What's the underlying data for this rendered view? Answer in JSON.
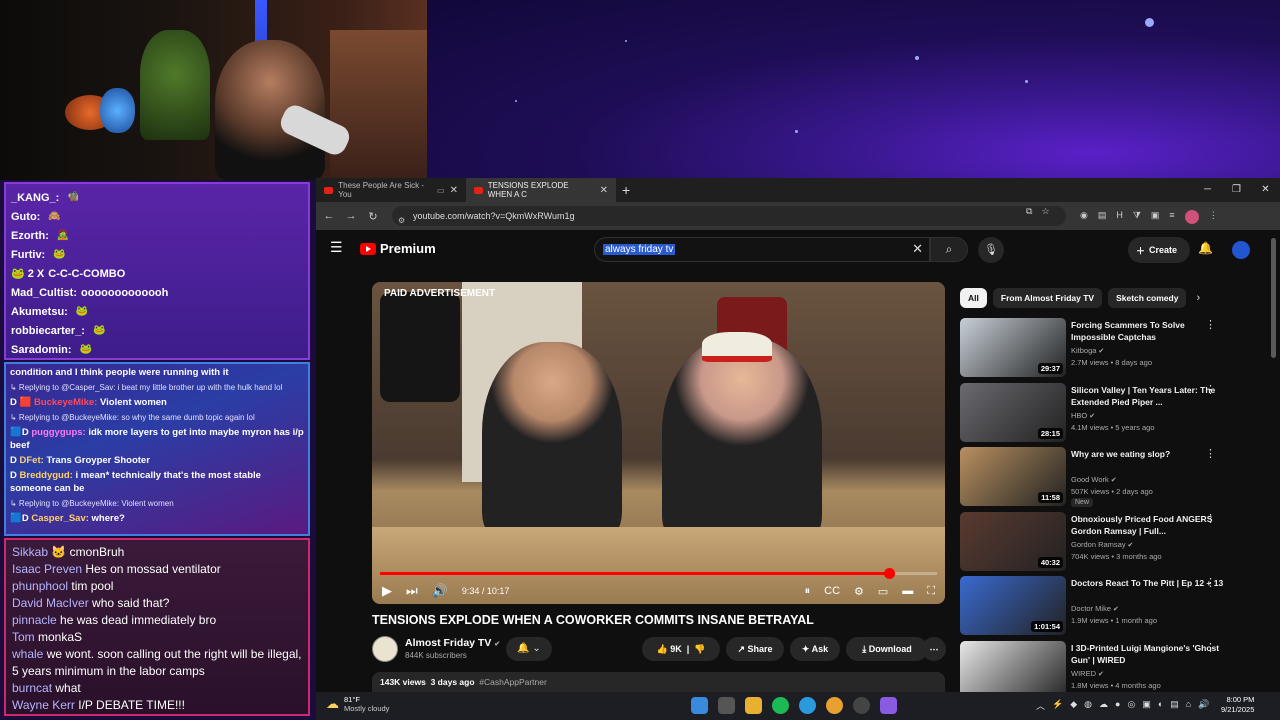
{
  "chat_top": [
    {
      "user": "_KANG_:",
      "msg": "",
      "emote": "🧌"
    },
    {
      "user": "Guto:",
      "msg": "",
      "emote": "🙈"
    },
    {
      "user": "Ezorth:",
      "msg": "",
      "emote": "🧟"
    },
    {
      "user": "Furtiv:",
      "msg": "",
      "emote": "🐸"
    },
    {
      "user": "🐸 2 X",
      "msg": "C-C-C-COMBO",
      "emote": ""
    },
    {
      "user": "Mad_Cultist:",
      "msg": "ooooooooooooh",
      "emote": ""
    },
    {
      "user": "Akumetsu:",
      "msg": "",
      "emote": "🐸"
    },
    {
      "user": "robbiecarter_:",
      "msg": "",
      "emote": "🐸"
    },
    {
      "user": "Saradomin:",
      "msg": "",
      "emote": "🐸"
    }
  ],
  "chat_mid": {
    "lead": "condition and I think people were running with it",
    "items": [
      {
        "reply": "↳ Replying to @Casper_Sav: i beat my little brother up with the hulk hand lol",
        "prefix": "D 🟥",
        "user": "BuckeyeMike:",
        "msg": "Violent women",
        "color": "red"
      },
      {
        "reply": "↳ Replying to @BuckeyeMike: so why the same dumb topic again lol",
        "prefix": "🟦D",
        "user": "puggygups:",
        "msg": "idk more layers to get into maybe myron has i/p beef",
        "color": "pink"
      },
      {
        "reply": "",
        "prefix": "D",
        "user": "DFet:",
        "msg": "Trans Groyper Shooter",
        "color": "yellow"
      },
      {
        "reply": "",
        "prefix": "D",
        "user": "Breddygud:",
        "msg": "i mean* technically that's the most stable someone can be",
        "color": "yellow"
      },
      {
        "reply": "↳ Replying to @BuckeyeMike: Violent women",
        "prefix": "🟦D",
        "user": "Casper_Sav:",
        "msg": "where?",
        "color": "yellow"
      }
    ]
  },
  "chat_bottom": [
    {
      "user": "Sikkab",
      "msg": "🐱 cmonBruh"
    },
    {
      "user": "Isaac Preven",
      "msg": "Hes on mossad ventilator"
    },
    {
      "user": "phunphool",
      "msg": "tim pool"
    },
    {
      "user": "David MacIver",
      "msg": "who said that?"
    },
    {
      "user": "pinnacle",
      "msg": "he was dead immediately bro"
    },
    {
      "user": "Tom",
      "msg": "monkaS"
    },
    {
      "user": "whale",
      "msg": "we wont. soon calling out the right will be illegal, 5 years minimum in the labor camps"
    },
    {
      "user": "burncat",
      "msg": "what"
    },
    {
      "user": "Wayne Kerr",
      "msg": "I/P DEBATE TIME!!!"
    }
  ],
  "browser": {
    "tabs": [
      {
        "title": "These People Are Sick - You",
        "active": false
      },
      {
        "title": "TENSIONS EXPLODE WHEN A C",
        "active": true
      }
    ],
    "url": "youtube.com/watch?v=QkmWxRWum1g"
  },
  "youtube": {
    "logo_text": "Premium",
    "search_value": "always friday tv",
    "create_label": "Create",
    "video": {
      "overlay": "PAID ADVERTISEMENT",
      "time": "9:34 / 10:17",
      "progress": 0.914,
      "title": "TENSIONS EXPLODE WHEN A COWORKER COMMITS INSANE BETRAYAL",
      "channel": "Almost Friday TV",
      "subs": "844K subscribers",
      "likes": "9K",
      "share": "Share",
      "ask": "Ask",
      "download": "Download",
      "views": "143K views",
      "age": "3 days ago",
      "hashtag": "#CashAppPartner"
    },
    "chips": [
      "All",
      "From Almost Friday TV",
      "Sketch comedy"
    ],
    "recs": [
      {
        "title": "Forcing Scammers To Solve Impossible Captchas",
        "channel": "Kitboga",
        "meta": "2.7M views • 8 days ago",
        "dur": "29:37",
        "badge": "",
        "color": "#c8d0d8"
      },
      {
        "title": "Silicon Valley | Ten Years Later: The Extended Pied Piper ...",
        "channel": "HBO",
        "meta": "4.1M views • 5 years ago",
        "dur": "28:15",
        "badge": "",
        "color": "#6a6a70"
      },
      {
        "title": "Why are we eating slop?",
        "channel": "Good Work",
        "meta": "507K views • 2 days ago",
        "dur": "11:58",
        "badge": "New",
        "color": "#b89060"
      },
      {
        "title": "Obnoxiously Priced Food ANGERS Gordon Ramsay | Full...",
        "channel": "Gordon Ramsay",
        "meta": "704K views • 3 months ago",
        "dur": "40:32",
        "badge": "",
        "color": "#5a3a30"
      },
      {
        "title": "Doctors React To The Pitt | Ep 12 + 13",
        "channel": "Doctor Mike",
        "meta": "1.9M views • 1 month ago",
        "dur": "1:01:54",
        "badge": "",
        "color": "#3a6ad0"
      },
      {
        "title": "I 3D-Printed Luigi Mangione's 'Ghost Gun' | WIRED",
        "channel": "WIRED",
        "meta": "1.8M views • 4 months ago",
        "dur": "",
        "badge": "",
        "color": "#e8e8e8"
      }
    ]
  },
  "taskbar": {
    "temp": "81°F",
    "condition": "Mostly cloudy",
    "time": "8:00 PM",
    "date": "9/21/2025"
  }
}
